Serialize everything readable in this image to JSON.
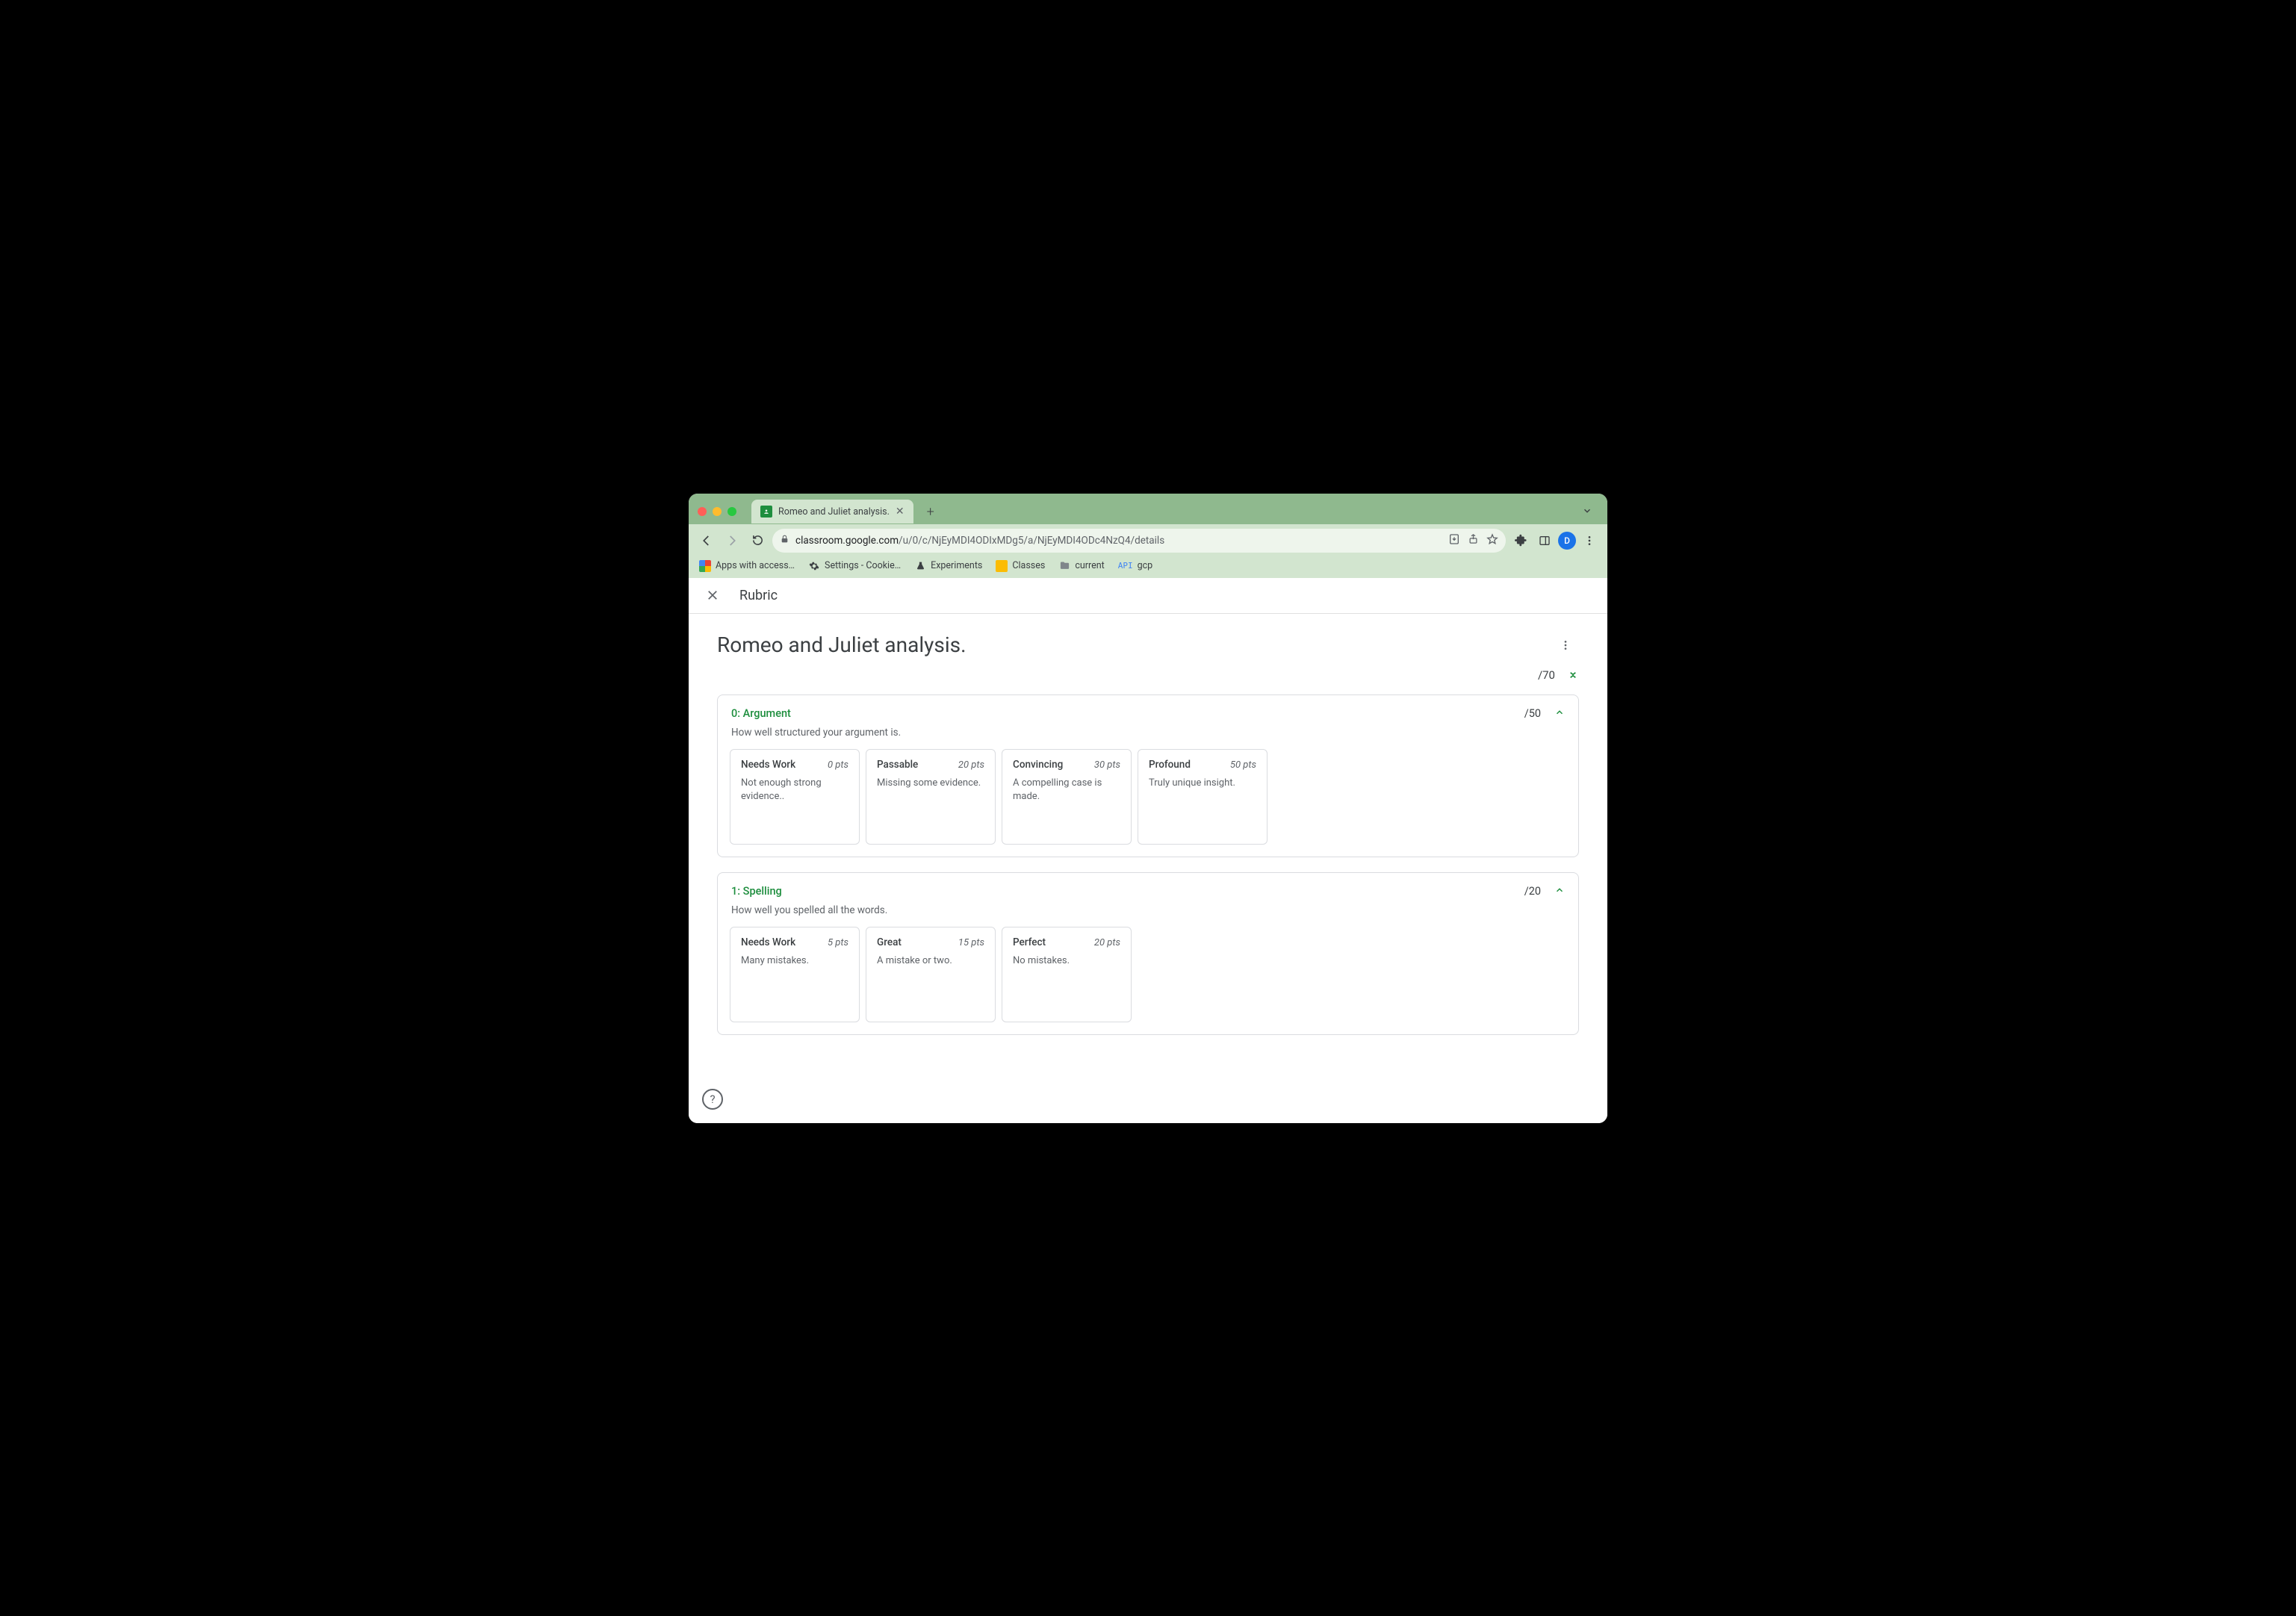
{
  "browser": {
    "tab_title": "Romeo and Juliet analysis.",
    "url_display_prefix": "classroom.google.com",
    "url_display_path": "/u/0/c/NjEyMDI4ODIxMDg5/a/NjEyMDI4ODc4NzQ4/details",
    "bookmarks": {
      "apps": "Apps with access…",
      "settings": "Settings - Cookie…",
      "experiments": "Experiments",
      "classes": "Classes",
      "current": "current",
      "api": "API",
      "gcp": "gcp"
    },
    "avatar_letter": "D"
  },
  "page": {
    "topbar_label": "Rubric",
    "assignment_title": "Romeo and Juliet analysis.",
    "total_points_label": "/70"
  },
  "criteria": [
    {
      "title": "0: Argument",
      "points_label": "/50",
      "description": "How well structured your argument is.",
      "levels": [
        {
          "title": "Needs Work",
          "pts": "0 pts",
          "desc": "Not enough strong evidence.."
        },
        {
          "title": "Passable",
          "pts": "20 pts",
          "desc": "Missing some evidence."
        },
        {
          "title": "Convincing",
          "pts": "30 pts",
          "desc": "A compelling case is made."
        },
        {
          "title": "Profound",
          "pts": "50 pts",
          "desc": "Truly unique insight."
        }
      ]
    },
    {
      "title": "1: Spelling",
      "points_label": "/20",
      "description": "How well you spelled all the words.",
      "levels": [
        {
          "title": "Needs Work",
          "pts": "5 pts",
          "desc": "Many mistakes."
        },
        {
          "title": "Great",
          "pts": "15 pts",
          "desc": "A mistake or two."
        },
        {
          "title": "Perfect",
          "pts": "20 pts",
          "desc": "No mistakes."
        }
      ]
    }
  ]
}
